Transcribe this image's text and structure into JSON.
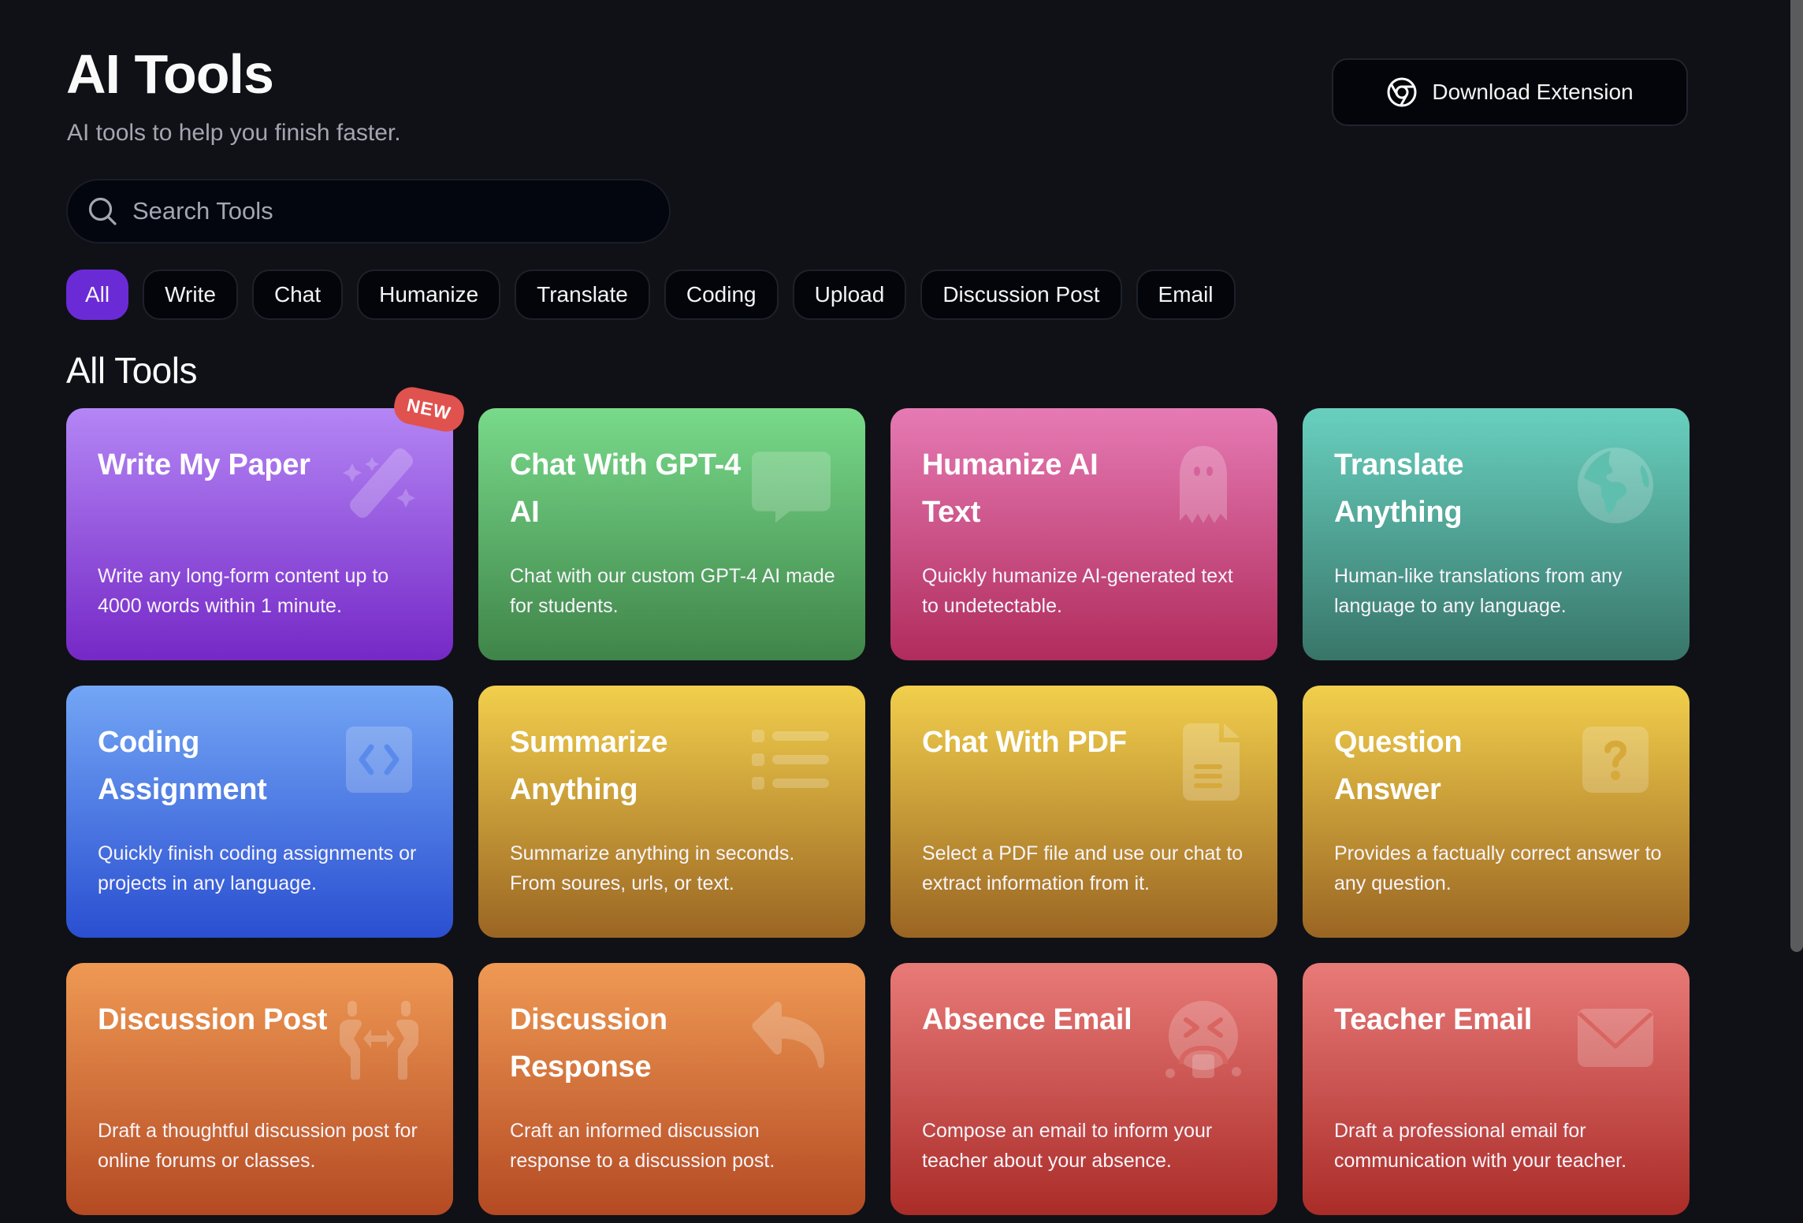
{
  "header": {
    "title": "AI Tools",
    "subtitle": "AI tools to help you finish faster.",
    "download_button": {
      "label": "Download Extension",
      "icon": "chrome-icon"
    }
  },
  "search": {
    "placeholder": "Search Tools",
    "value": "",
    "icon": "search-icon"
  },
  "filters": {
    "active": "All",
    "items": [
      "All",
      "Write",
      "Chat",
      "Humanize",
      "Translate",
      "Coding",
      "Upload",
      "Discussion Post",
      "Email"
    ]
  },
  "section_title": "All Tools",
  "accent_color": "#6a2bd6",
  "tools": [
    {
      "title": "Write My Paper",
      "description": "Write any long-form content up to 4000 words within 1 minute.",
      "icon": "magic-wand-icon",
      "badge": "NEW",
      "gradient": [
        "#b486f5",
        "#7528c6"
      ]
    },
    {
      "title": "Chat With GPT-4 AI",
      "description": "Chat with our custom GPT-4 AI made for students.",
      "icon": "chat-bubble-icon",
      "badge": null,
      "gradient": [
        "#78da8a",
        "#3f8449"
      ]
    },
    {
      "title": "Humanize AI Text",
      "description": "Quickly humanize AI-generated text to undetectable.",
      "icon": "ghost-icon",
      "badge": null,
      "gradient": [
        "#e67ab4",
        "#b02c5c"
      ]
    },
    {
      "title": "Translate Anything",
      "description": "Human-like translations from any language to any language.",
      "icon": "globe-icon",
      "badge": null,
      "gradient": [
        "#68d0bf",
        "#387569"
      ]
    },
    {
      "title": "Coding Assignment",
      "description": "Quickly finish coding assignments or projects in any language.",
      "icon": "code-icon",
      "badge": null,
      "gradient": [
        "#73a6f5",
        "#2a4fd1"
      ]
    },
    {
      "title": "Summarize Anything",
      "description": "Summarize anything in seconds. From soures, urls, or text.",
      "icon": "list-icon",
      "badge": null,
      "gradient": [
        "#f2cf4c",
        "#9a6523"
      ]
    },
    {
      "title": "Chat With PDF",
      "description": "Select a PDF file and use our chat to extract information from it.",
      "icon": "document-icon",
      "badge": null,
      "gradient": [
        "#f2cf4c",
        "#9a6523"
      ]
    },
    {
      "title": "Question Answer",
      "description": "Provides a factually correct answer to any question.",
      "icon": "question-icon",
      "badge": null,
      "gradient": [
        "#f2cf4c",
        "#9a6523"
      ]
    },
    {
      "title": "Discussion Post",
      "description": "Draft a thoughtful discussion post for online forums or classes.",
      "icon": "people-exchange-icon",
      "badge": null,
      "gradient": [
        "#ef9954",
        "#b44a23"
      ]
    },
    {
      "title": "Discussion Response",
      "description": "Craft an informed discussion response to a discussion post.",
      "icon": "reply-icon",
      "badge": null,
      "gradient": [
        "#ef9954",
        "#b44a23"
      ]
    },
    {
      "title": "Absence Email",
      "description": "Compose an email to inform your teacher about your absence.",
      "icon": "sick-face-icon",
      "badge": null,
      "gradient": [
        "#e87a78",
        "#aa2c28"
      ]
    },
    {
      "title": "Teacher Email",
      "description": "Draft a professional email for communication with your teacher.",
      "icon": "envelope-icon",
      "badge": null,
      "gradient": [
        "#e87a78",
        "#aa2c28"
      ]
    }
  ]
}
